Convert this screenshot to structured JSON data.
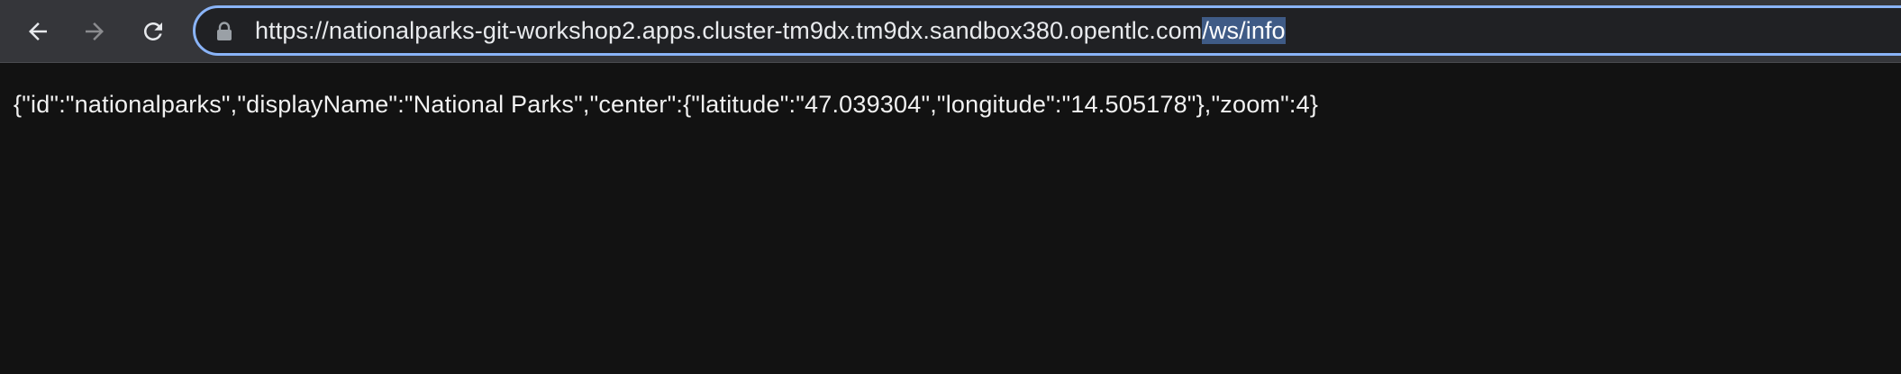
{
  "browser": {
    "icons": {
      "back": "arrow-left-icon",
      "forward": "arrow-right-icon",
      "reload": "reload-icon",
      "lock": "lock-icon"
    },
    "url": {
      "unselected": "https://nationalparks-git-workshop2.apps.cluster-tm9dx.tm9dx.sandbox380.opentlc.com",
      "selected": "/ws/info"
    },
    "colors": {
      "toolbar": "#35363a",
      "omnibox": "#202124",
      "focus_ring": "#8ab4f8",
      "selection": "#3f5b86",
      "page_background": "#121212"
    }
  },
  "page": {
    "body_text": "{\"id\":\"nationalparks\",\"displayName\":\"National Parks\",\"center\":{\"latitude\":\"47.039304\",\"longitude\":\"14.505178\"},\"zoom\":4}"
  }
}
